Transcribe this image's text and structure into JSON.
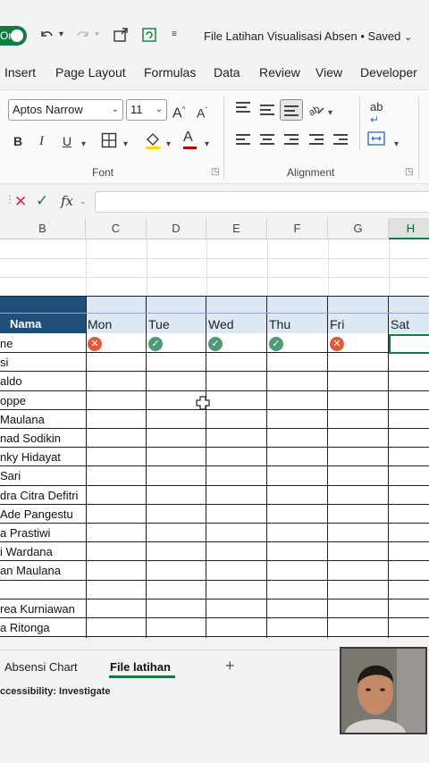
{
  "titlebar": {
    "autosave_label": "On",
    "document_title": "File Latihan Visualisasi Absen • Saved",
    "icons": [
      "undo-icon",
      "redo-icon",
      "new-window-icon",
      "refresh-icon",
      "customize-toolbar-icon",
      "chevron-down-icon"
    ]
  },
  "ribbon_tabs": [
    "Insert",
    "Page Layout",
    "Formulas",
    "Data",
    "Review",
    "View",
    "Developer"
  ],
  "font_group": {
    "font_name": "Aptos Narrow",
    "font_size": "11",
    "grow_label": "A",
    "shrink_label": "A",
    "bold": "B",
    "italic": "I",
    "underline": "U",
    "font_color_label": "A",
    "font_color": "#c00000",
    "label": "Font"
  },
  "alignment_group": {
    "label": "Alignment",
    "wrap_label": "ab"
  },
  "formula_bar": {
    "fx": "fx",
    "value": ""
  },
  "columns": [
    "B",
    "C",
    "D",
    "E",
    "F",
    "G",
    "H"
  ],
  "active_column": "H",
  "table": {
    "header": "Nama",
    "days": [
      "Mon",
      "Tue",
      "Wed",
      "Thu",
      "Fri",
      "Sat"
    ],
    "header_fill": "#1f4e78",
    "day_fill": "#dce8f4",
    "rows": [
      {
        "name": "ne"
      },
      {
        "name": "si"
      },
      {
        "name": "aldo"
      },
      {
        "name": "oppe"
      },
      {
        "name": "Maulana"
      },
      {
        "name": "nad Sodikin"
      },
      {
        "name": "nky Hidayat"
      },
      {
        "name": "Sari"
      },
      {
        "name": "dra Citra Defitri"
      },
      {
        "name": "Ade Pangestu"
      },
      {
        "name": "a Prastiwi"
      },
      {
        "name": "i Wardana"
      },
      {
        "name": "an Maulana"
      },
      {
        "name": ""
      },
      {
        "name": "rea Kurniawan"
      },
      {
        "name": "a Ritonga"
      }
    ],
    "first_row_status": [
      "absent",
      "present",
      "present",
      "present",
      "absent",
      ""
    ],
    "present_color": "#4f9a74",
    "absent_color": "#e05a3a"
  },
  "sheet_tabs": {
    "tabs": [
      "Absensi Chart",
      "File latihan"
    ],
    "active": "File latihan",
    "add_label": "+"
  },
  "status_bar": {
    "accessibility": "ccessibility: Investigate"
  },
  "accent": "#107c41"
}
